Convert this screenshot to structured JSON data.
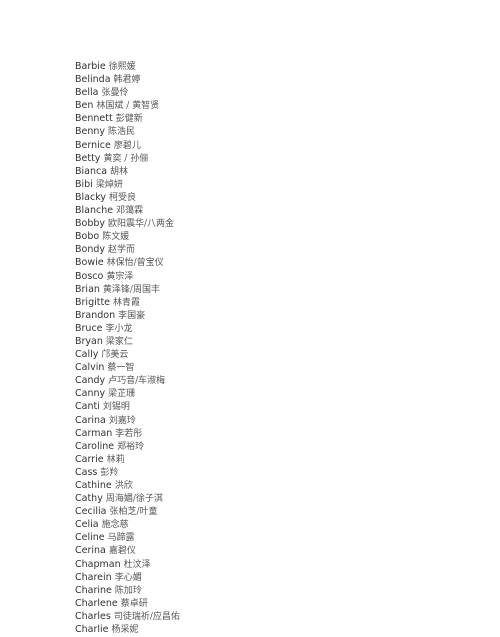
{
  "document": {
    "entries": [
      {
        "en": "Barbie",
        "zh": "徐熙媛"
      },
      {
        "en": "Belinda",
        "zh": "韩君婷"
      },
      {
        "en": "Bella",
        "zh": "张曼伶"
      },
      {
        "en": "Ben",
        "zh": "林国斌 / 黄智贤"
      },
      {
        "en": "Bennett",
        "zh": "彭健新"
      },
      {
        "en": "Benny",
        "zh": "陈浩民"
      },
      {
        "en": "Bernice",
        "zh": "廖碧儿"
      },
      {
        "en": "Betty",
        "zh": "黄奕 / 孙俪"
      },
      {
        "en": "Bianca",
        "zh": "胡林"
      },
      {
        "en": "Bibi",
        "zh": "梁焯妍"
      },
      {
        "en": "Blacky",
        "zh": "柯受良"
      },
      {
        "en": "Blanche",
        "zh": "邓蔼霖"
      },
      {
        "en": "Bobby",
        "zh": "欧阳震华/八两金"
      },
      {
        "en": "Bobo",
        "zh": "陈文媛"
      },
      {
        "en": "Bondy",
        "zh": "赵学而"
      },
      {
        "en": "Bowie",
        "zh": "林保怡/曾宝仪"
      },
      {
        "en": "Bosco",
        "zh": "黄宗泽"
      },
      {
        "en": "Brian",
        "zh": "黄泽锋/周国丰"
      },
      {
        "en": "Brigitte",
        "zh": "林青霞"
      },
      {
        "en": "Brandon",
        "zh": "李国豪"
      },
      {
        "en": "Bruce",
        "zh": "李小龙"
      },
      {
        "en": "Bryan",
        "zh": "梁家仁"
      },
      {
        "en": "Cally",
        "zh": "邝美云"
      },
      {
        "en": "Calvin",
        "zh": "蔡一智"
      },
      {
        "en": "Candy",
        "zh": "卢巧音/车淑梅"
      },
      {
        "en": "Canny",
        "zh": "梁芷珊"
      },
      {
        "en": "Canti",
        "zh": "刘锡明"
      },
      {
        "en": "Carina",
        "zh": "刘嘉玲"
      },
      {
        "en": "Carman",
        "zh": "李若彤"
      },
      {
        "en": "Caroline",
        "zh": "郑裕玲"
      },
      {
        "en": "Carrie",
        "zh": "林莉"
      },
      {
        "en": "Cass",
        "zh": "彭羚"
      },
      {
        "en": "Cathine",
        "zh": "洪欣"
      },
      {
        "en": "Cathy",
        "zh": "周海媚/徐子淇"
      },
      {
        "en": "Cecilia",
        "zh": "张柏芝/叶童"
      },
      {
        "en": "Celia",
        "zh": "施念慈"
      },
      {
        "en": "Celine",
        "zh": "马蹄露"
      },
      {
        "en": "Cerina",
        "zh": "嘉碧仪"
      },
      {
        "en": "Chapman",
        "zh": "杜汶泽"
      },
      {
        "en": "Charein",
        "zh": "李心媚"
      },
      {
        "en": "Charine",
        "zh": "陈加玲"
      },
      {
        "en": "Charlene",
        "zh": "蔡卓研"
      },
      {
        "en": "Charles",
        "zh": "司徒瑞祈/应昌佑"
      },
      {
        "en": "Charlie",
        "zh": "杨采妮"
      }
    ]
  }
}
